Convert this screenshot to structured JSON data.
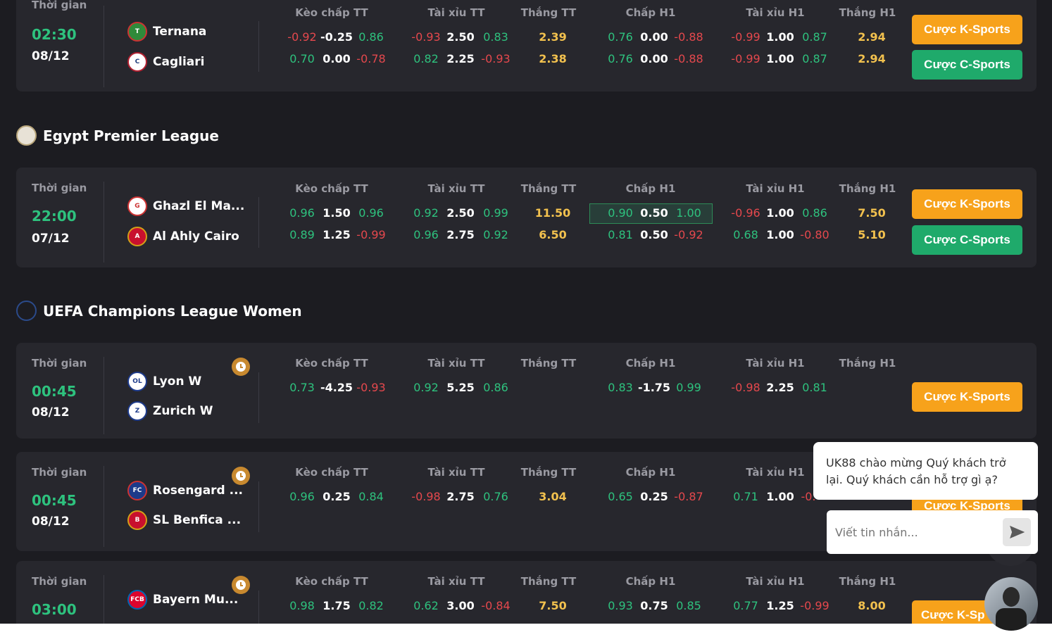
{
  "colors": {
    "accent_green": "#2ec27e",
    "odd_red": "#e5484d",
    "win_yellow": "#f2c14e",
    "btn_k": "#f7a21b",
    "btn_c": "#1faa6b",
    "bg": "#1c1c21",
    "card": "#27272d"
  },
  "headers": {
    "time": "Thời gian",
    "hdp_ft": "Kèo chấp TT",
    "ou_ft": "Tài xỉu TT",
    "win_ft": "Thắng TT",
    "hdp_h1": "Chấp H1",
    "ou_h1": "Tài xỉu H1",
    "win_h1": "Thắng H1"
  },
  "buttons": {
    "k_sports": "Cược K-Sports",
    "c_sports": "Cược C-Sports"
  },
  "leagues": {
    "egypt": "Egypt Premier League",
    "uefa_women": "UEFA Champions League Women"
  },
  "matches": [
    {
      "time": "02:30",
      "date": "08/12",
      "home": "Ternana",
      "away": "Cagliari",
      "home_logo": "ternana-logo-icon",
      "away_logo": "cagliari-logo-icon",
      "r1": {
        "hdp": [
          "-0.92",
          "-0.25",
          "0.86"
        ],
        "ou": [
          "-0.93",
          "2.50",
          "0.83"
        ],
        "win": "2.39",
        "hdp1": [
          "0.76",
          "0.00",
          "-0.88"
        ],
        "ou1": [
          "-0.99",
          "1.00",
          "0.87"
        ],
        "win1": "2.94"
      },
      "r2": {
        "hdp": [
          "0.70",
          "0.00",
          "-0.78"
        ],
        "ou": [
          "0.82",
          "2.25",
          "-0.93"
        ],
        "win": "2.38",
        "hdp1": [
          "0.76",
          "0.00",
          "-0.88"
        ],
        "ou1": [
          "-0.99",
          "1.00",
          "0.87"
        ],
        "win1": "2.94"
      }
    },
    {
      "time": "22:00",
      "date": "07/12",
      "home": "Ghazl El Ma...",
      "away": "Al Ahly Cairo",
      "r1": {
        "hdp": [
          "0.96",
          "1.50",
          "0.96"
        ],
        "ou": [
          "0.92",
          "2.50",
          "0.99"
        ],
        "win": "11.50",
        "hdp1": [
          "0.90",
          "0.50",
          "1.00"
        ],
        "ou1": [
          "-0.96",
          "1.00",
          "0.86"
        ],
        "win1": "7.50"
      },
      "r2": {
        "hdp": [
          "0.89",
          "1.25",
          "-0.99"
        ],
        "ou": [
          "0.96",
          "2.75",
          "0.92"
        ],
        "win": "6.50",
        "hdp1": [
          "0.81",
          "0.50",
          "-0.92"
        ],
        "ou1": [
          "0.68",
          "1.00",
          "-0.80"
        ],
        "win1": "5.10"
      }
    },
    {
      "time": "00:45",
      "date": "08/12",
      "home": "Lyon W",
      "away": "Zurich W",
      "r1": {
        "hdp": [
          "0.73",
          "-4.25",
          "-0.93"
        ],
        "ou": [
          "0.92",
          "5.25",
          "0.86"
        ],
        "hdp1": [
          "0.83",
          "-1.75",
          "0.99"
        ],
        "ou1": [
          "-0.98",
          "2.25",
          "0.81"
        ]
      }
    },
    {
      "time": "00:45",
      "date": "08/12",
      "home": "Rosengard ...",
      "away": "SL Benfica ...",
      "r1": {
        "hdp": [
          "0.96",
          "0.25",
          "0.84"
        ],
        "ou": [
          "-0.98",
          "2.75",
          "0.76"
        ],
        "win": "3.04",
        "hdp1": [
          "0.65",
          "0.25",
          "-0.87"
        ],
        "ou1": [
          "0.71",
          "1.00",
          "-0."
        ]
      }
    },
    {
      "time": "03:00",
      "home": "Bayern Mu...",
      "r1": {
        "hdp": [
          "0.98",
          "1.75",
          "0.82"
        ],
        "ou": [
          "0.62",
          "3.00",
          "-0.84"
        ],
        "win": "7.50",
        "hdp1": [
          "0.93",
          "0.75",
          "0.85"
        ],
        "ou1": [
          "0.77",
          "1.25",
          "-0.99"
        ],
        "win1": "8.00"
      }
    }
  ],
  "partial_button": "Cược K-Sp",
  "chat": {
    "greeting": "UK88 chào mừng Quý khách trở lại. Quý khách cần hỗ trợ gì ạ?",
    "placeholder": "Viết tin nhắn..."
  }
}
